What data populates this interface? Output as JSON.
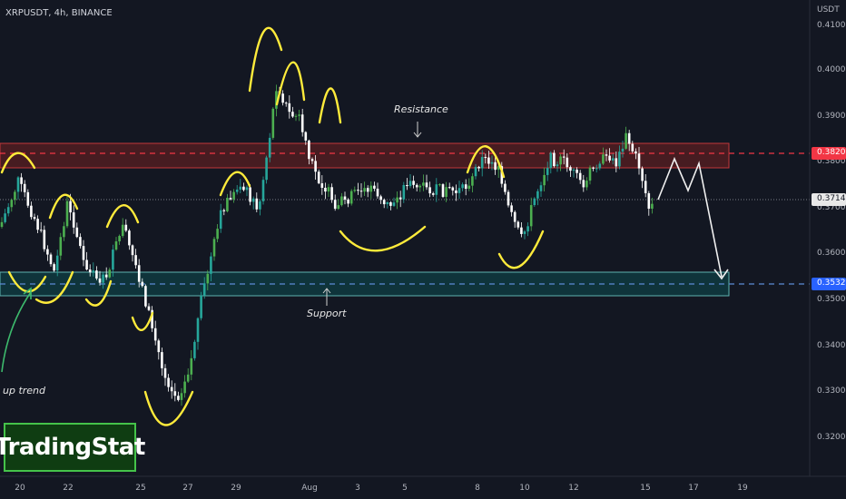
{
  "header": {
    "title": "XRPUSDT, 4h, BINANCE",
    "unit": "USDT"
  },
  "y_axis_ticks": [
    "0.4100",
    "0.4000",
    "0.3900",
    "0.3800",
    "0.3700",
    "0.3600",
    "0.3500",
    "0.3400",
    "0.3300",
    "0.3200"
  ],
  "price_labels": {
    "resistance": {
      "text": "0.3820",
      "color": "#f23645"
    },
    "current": {
      "text": "0.3714",
      "color": "#e8e8e8"
    },
    "support": {
      "text": "0.3532",
      "color": "#2962ff"
    }
  },
  "x_axis_ticks": [
    "20",
    "22",
    "25",
    "27",
    "29",
    "Aug",
    "3",
    "5",
    "8",
    "10",
    "12",
    "15",
    "17",
    "19"
  ],
  "annotations": {
    "resistance": "Resistance",
    "support": "Support",
    "uptrend": "up trend"
  },
  "logo": "TradingStat",
  "colors": {
    "up": "#26a69a",
    "up_bright": "#4caf50",
    "down": "#ffffff",
    "highlight": "#ffeb3b",
    "zone_red": "#b2393b",
    "zone_teal": "#2c8b8c"
  }
}
